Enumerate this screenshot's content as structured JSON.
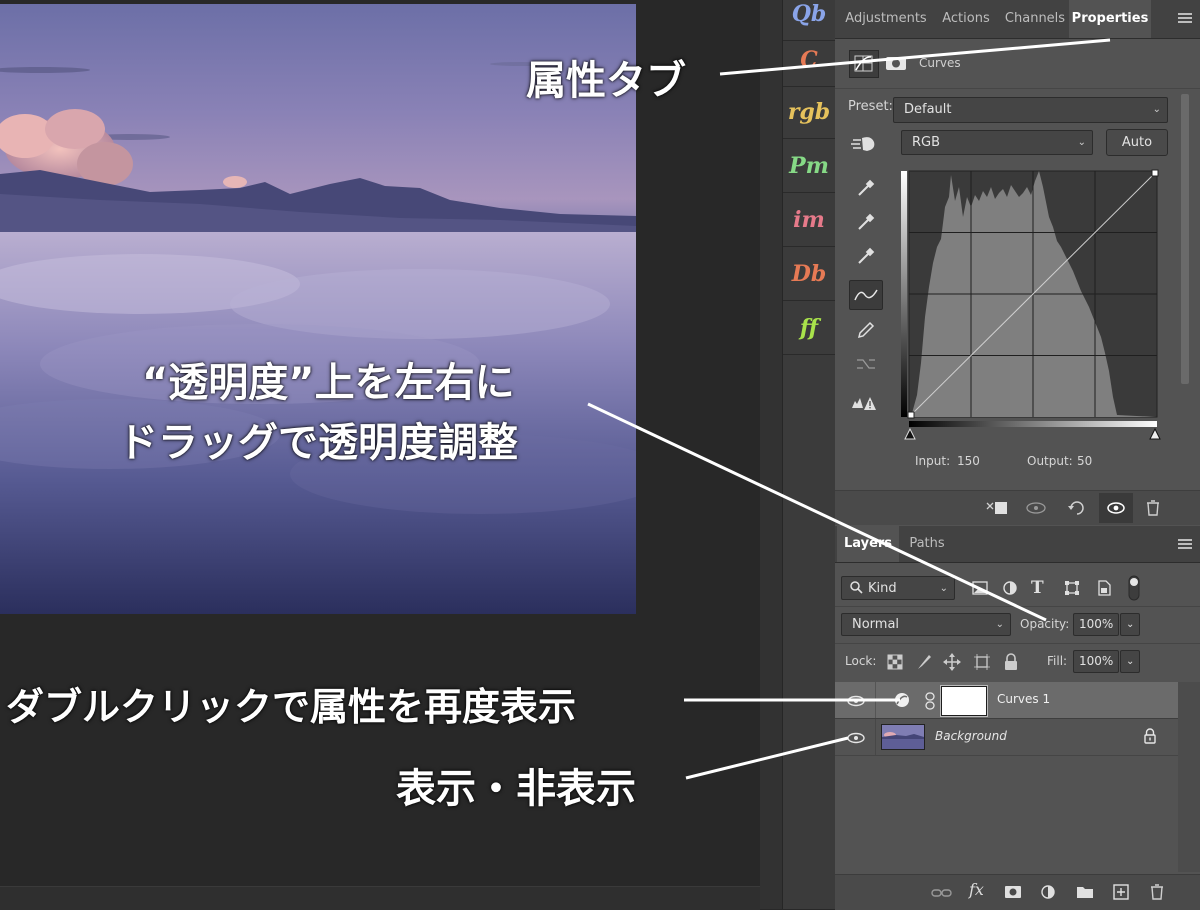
{
  "plugins": [
    {
      "label": "Qb",
      "color": "#8aa4e8"
    },
    {
      "label": "C",
      "color": "#e67a55"
    },
    {
      "label": "rgb",
      "color": "#e6c25c"
    },
    {
      "label": "Pm",
      "color": "#86d986"
    },
    {
      "label": "im",
      "color": "#e67a8a"
    },
    {
      "label": "Db",
      "color": "#e67a55"
    },
    {
      "label": "ff",
      "color": "#a9e34b"
    }
  ],
  "properties": {
    "tabs": [
      "Adjustments",
      "Actions",
      "Channels",
      "Properties"
    ],
    "active_tab": "Properties",
    "adjustment_title": "Curves",
    "preset_label": "Preset:",
    "preset_value": "Default",
    "channel_value": "RGB",
    "auto_label": "Auto",
    "input_label": "Input:",
    "input_value": "150",
    "output_label": "Output:",
    "output_value": "50"
  },
  "layers": {
    "tabs": [
      "Layers",
      "Paths"
    ],
    "active_tab": "Layers",
    "filter_kind": "Kind",
    "blend_mode": "Normal",
    "opacity_label": "Opacity:",
    "opacity_value": "100%",
    "lock_label": "Lock:",
    "fill_label": "Fill:",
    "fill_value": "100%",
    "rows": [
      {
        "name": "Curves 1"
      },
      {
        "name": "Background"
      }
    ],
    "footer_fx": "fx"
  },
  "annotations": {
    "properties_tab": "属性タブ",
    "opacity_line1": "“透明度”上を左右に",
    "opacity_line2": "ドラッグで透明度調整",
    "double_click": "ダブルクリックで属性を再度表示",
    "visibility": "表示・非表示"
  },
  "colors": {
    "panel_bg": "#535353",
    "tab_bg": "#424242",
    "canvas_bg": "#282828",
    "selected_row": "#6b6b6b"
  }
}
